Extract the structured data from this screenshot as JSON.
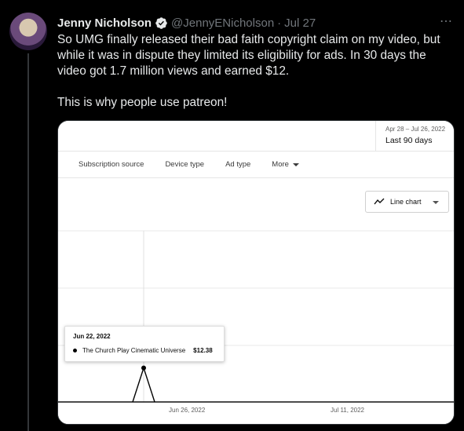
{
  "tweet": {
    "author_name": "Jenny Nicholson",
    "handle": "@JennyENicholson",
    "separator": "·",
    "date": "Jul 27",
    "more_icon": "⋯",
    "text_1": "So UMG finally released their bad faith copyright claim on my video, but while it was in dispute they limited its eligibility for ads. In 30 days the video got 1.7 million views and earned $12.",
    "text_2": "This is why people use patreon!"
  },
  "analytics": {
    "date_range": "Apr 28 – Jul 26, 2022",
    "date_label": "Last 90 days",
    "tabs": [
      {
        "label": "Subscription source"
      },
      {
        "label": "Device type"
      },
      {
        "label": "Ad type"
      },
      {
        "label": "More"
      }
    ],
    "chart_type_label": "Line chart",
    "tooltip": {
      "date": "Jun 22, 2022",
      "series": "The Church Play Cinematic Universe",
      "value": "$12.38"
    }
  },
  "chart_data": {
    "type": "line",
    "x_ticks": [
      "Jun 26, 2022",
      "Jul 11, 2022"
    ],
    "series": [
      {
        "name": "The Church Play Cinematic Universe",
        "points": [
          {
            "x": "Jun 21, 2022",
            "y": 0
          },
          {
            "x": "Jun 22, 2022",
            "y": 12.38
          },
          {
            "x": "Jun 23, 2022",
            "y": 0
          }
        ]
      }
    ],
    "grid": true,
    "line_color": "#000000"
  }
}
